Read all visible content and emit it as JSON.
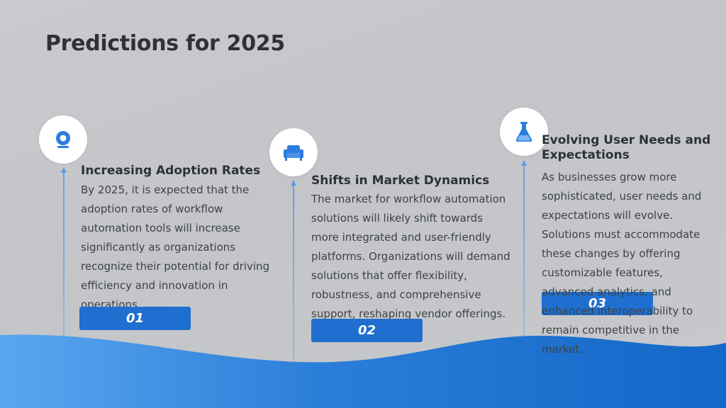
{
  "title": "Predictions for 2025",
  "accent_color": "#1f6fd0",
  "items": [
    {
      "icon": "target-icon",
      "number": "01",
      "heading": "Increasing Adoption Rates",
      "body": "By 2025, it is expected that the adoption rates of workflow automation tools will increase significantly as organizations recognize their potential for driving efficiency and innovation in operations."
    },
    {
      "icon": "sofa-icon",
      "number": "02",
      "heading": "Shifts in Market Dynamics",
      "body": "The market for workflow automation solutions will likely shift towards more integrated and user-friendly platforms. Organizations will demand solutions that offer flexibility, robustness, and comprehensive support, reshaping vendor offerings."
    },
    {
      "icon": "flask-icon",
      "number": "03",
      "heading": "Evolving User Needs and Expectations",
      "body": "As businesses grow more sophisticated, user needs and expectations will evolve. Solutions must accommodate these changes by offering customizable features, advanced analytics, and enhanced interoperability to remain competitive in the market."
    }
  ]
}
